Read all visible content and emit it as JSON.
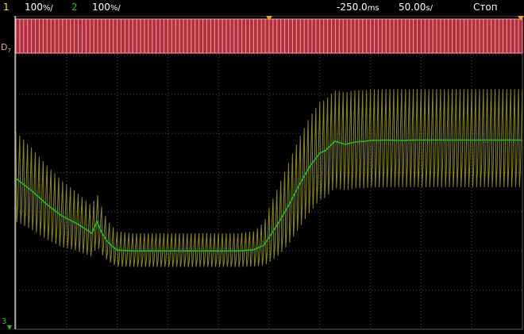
{
  "status": {
    "ch1_num": "1",
    "ch1_scale": "100",
    "ch1_unit": "%/",
    "ch2_num": "2",
    "ch2_scale": "100",
    "ch2_unit": "%/",
    "delay": "-250.0",
    "delay_unit": "ms",
    "timebase": "50.00",
    "timebase_unit": "s/",
    "run_state": "Стоп"
  },
  "digital": {
    "label": "D",
    "index": "7"
  },
  "channel_marker": "3",
  "colors": {
    "ch1": "#c8c800",
    "ch1_dim": "#8a8a12",
    "ch2": "#19c419",
    "digital": "#ff9a9a",
    "digital_bg": "#b03040",
    "grid": "#4a4a4a",
    "marker": "#f0a020"
  },
  "chart_data": {
    "type": "line",
    "x_divisions": 10,
    "y_divisions": 8,
    "series": [
      {
        "channel": "2",
        "x": [
          0,
          0.3,
          0.6,
          0.9,
          1.2,
          1.5,
          1.6,
          1.7,
          1.8,
          1.9,
          2.0,
          2.3,
          2.6,
          2.9,
          3.2,
          3.5,
          3.8,
          4.1,
          4.4,
          4.7,
          4.9,
          5.0,
          5.2,
          5.4,
          5.6,
          5.8,
          6.0,
          6.1,
          6.3,
          6.5,
          6.7,
          6.9,
          7.0,
          7.3,
          7.6,
          7.9,
          8.2,
          8.5,
          8.8,
          9.1,
          9.4,
          9.7,
          10.0
        ],
        "y": [
          -0.15,
          -0.45,
          -0.8,
          -1.1,
          -1.3,
          -1.55,
          -1.25,
          -1.55,
          -1.75,
          -1.88,
          -1.98,
          -2.0,
          -2.0,
          -2.0,
          -2.0,
          -2.0,
          -2.0,
          -2.0,
          -2.0,
          -1.97,
          -1.85,
          -1.65,
          -1.25,
          -0.8,
          -0.3,
          0.15,
          0.5,
          0.55,
          0.8,
          0.72,
          0.78,
          0.8,
          0.82,
          0.83,
          0.82,
          0.83,
          0.83,
          0.83,
          0.83,
          0.83,
          0.83,
          0.83,
          0.83
        ]
      },
      {
        "channel": "1",
        "x": [
          0,
          0.3,
          0.6,
          0.9,
          1.2,
          1.5,
          1.6,
          1.7,
          1.8,
          1.9,
          2.0,
          2.3,
          2.6,
          2.9,
          3.2,
          3.5,
          3.8,
          4.1,
          4.4,
          4.7,
          4.9,
          5.0,
          5.2,
          5.4,
          5.6,
          5.8,
          6.0,
          6.1,
          6.3,
          6.5,
          6.7,
          6.9,
          7.0,
          7.3,
          7.6,
          7.9,
          8.2,
          8.5,
          8.8,
          9.1,
          9.4,
          9.7,
          10.0
        ],
        "y_center": [
          -0.1,
          -0.4,
          -0.75,
          -1.05,
          -1.25,
          -1.5,
          -1.2,
          -1.5,
          -1.72,
          -1.85,
          -1.95,
          -1.98,
          -1.98,
          -1.98,
          -1.98,
          -1.98,
          -1.98,
          -1.98,
          -1.98,
          -1.95,
          -1.82,
          -1.6,
          -1.2,
          -0.75,
          -0.25,
          0.2,
          0.55,
          0.6,
          0.85,
          0.8,
          0.85,
          0.85,
          0.87,
          0.88,
          0.88,
          0.88,
          0.88,
          0.88,
          0.88,
          0.88,
          0.88,
          0.88,
          0.88
        ],
        "amplitude": [
          1.15,
          1.05,
          0.95,
          0.85,
          0.75,
          0.65,
          0.68,
          0.6,
          0.52,
          0.48,
          0.45,
          0.43,
          0.43,
          0.43,
          0.43,
          0.43,
          0.43,
          0.43,
          0.43,
          0.45,
          0.55,
          0.7,
          0.9,
          1.05,
          1.15,
          1.22,
          1.25,
          1.25,
          1.25,
          1.25,
          1.25,
          1.25,
          1.25,
          1.25,
          1.25,
          1.25,
          1.25,
          1.25,
          1.25,
          1.25,
          1.25,
          1.25,
          1.25
        ],
        "cycles": 130
      }
    ],
    "digital_cycles": 130
  }
}
